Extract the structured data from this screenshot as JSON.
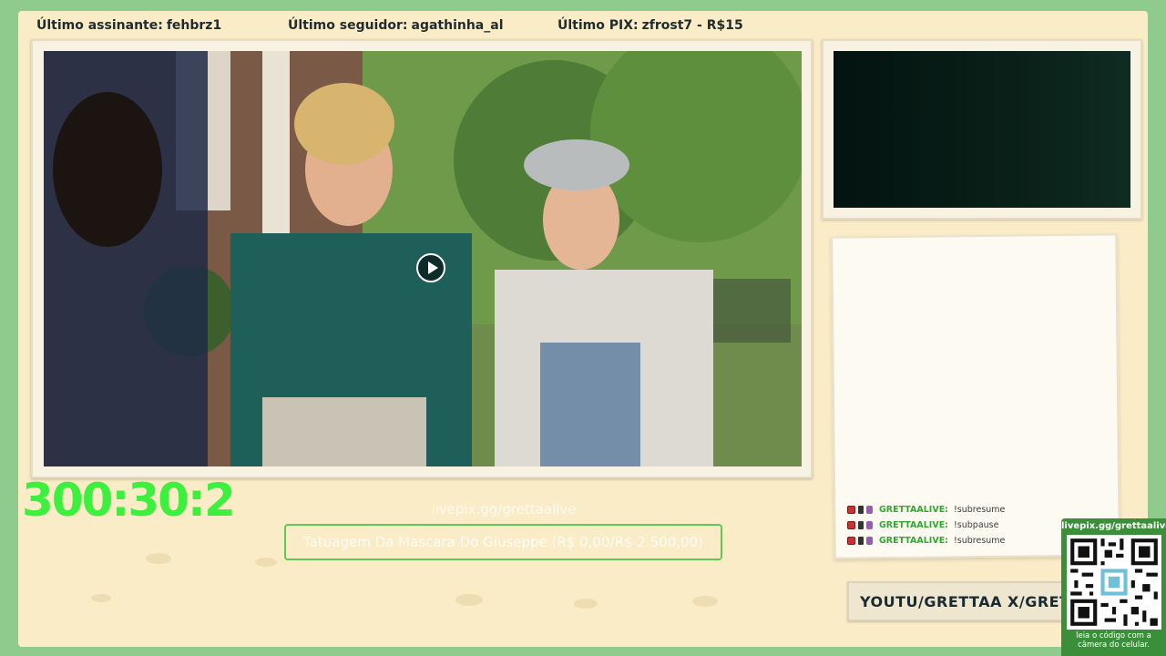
{
  "topbar": {
    "last_subscriber_label": "Último assinante:",
    "last_subscriber": "fehbrz1",
    "last_follower_label": "Último seguidor:",
    "last_follower": "agathinha_al",
    "last_pix_label": "Último PIX:",
    "last_pix": "zfrost7 - R$15"
  },
  "video": {
    "play_icon": "play-icon"
  },
  "timer": "300:30:2",
  "donation": {
    "link": "livepix.gg/grettaalive",
    "goal": "Tatuagem Da Mascara Do Giuseppe (R$ 0,00/R$ 2.500,00)"
  },
  "chat": {
    "messages": [
      {
        "user": "GRETTAALIVE:",
        "text": "!subresume"
      },
      {
        "user": "GRETTAALIVE:",
        "text": "!subpause"
      },
      {
        "user": "GRETTAALIVE:",
        "text": "!subresume"
      }
    ]
  },
  "socials": {
    "text": "YOUTU/GRETTAA X/GRETTAA"
  },
  "qr": {
    "title": "livepix.gg/grettaalive",
    "caption": "leia o código com a câmera do celular."
  },
  "colors": {
    "accent": "#3ef03e",
    "frame": "#fbecc8",
    "background": "#8fcb8c"
  }
}
